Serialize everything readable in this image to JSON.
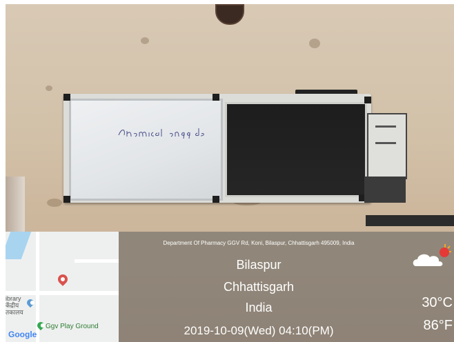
{
  "scene": {
    "whiteboard_text": "Chemical engg dep"
  },
  "map": {
    "labels": [
      "ibrary",
      "केंद्रीय",
      "तकालय"
    ],
    "park_label": "Ggv Play Ground",
    "logo": "Google",
    "pin_icon": "map-pin-icon",
    "park_icon": "park-pin-icon",
    "pin_color": "#d9534f",
    "park_color": "#34a853"
  },
  "location": {
    "address": "Department Of Pharmacy GGV Rd, Koni, Bilaspur, Chhattisgarh 495009, India",
    "city": "Bilaspur",
    "state": "Chhattisgarh",
    "country": "India",
    "datetime": "2019-10-09(Wed)   04:10(PM)"
  },
  "weather": {
    "icon": "partly-sunny-icon",
    "temp_c": "30°C",
    "temp_f": "86°F"
  }
}
